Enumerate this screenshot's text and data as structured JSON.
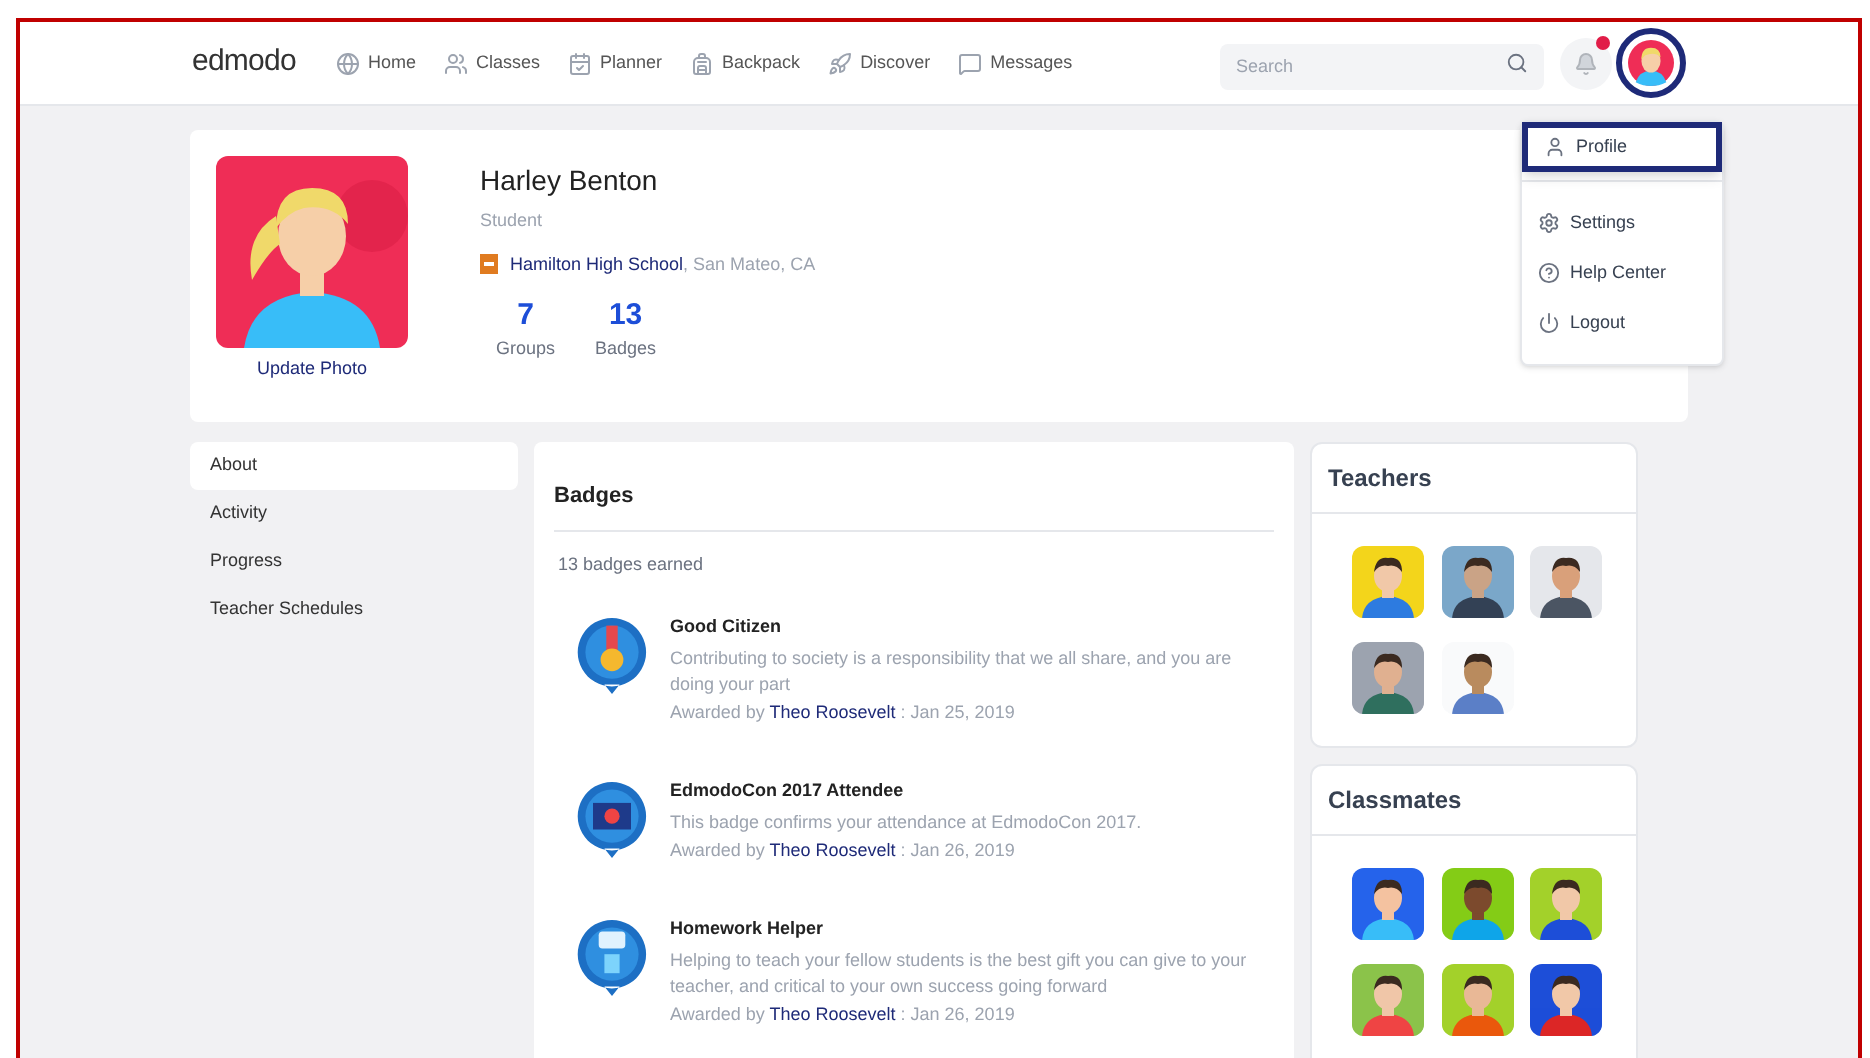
{
  "nav": {
    "logo": "edmodo",
    "items": [
      {
        "label": "Home",
        "kind": "home"
      },
      {
        "label": "Classes",
        "kind": "classes"
      },
      {
        "label": "Planner",
        "kind": "planner"
      },
      {
        "label": "Backpack",
        "kind": "backpack"
      },
      {
        "label": "Discover",
        "kind": "discover"
      },
      {
        "label": "Messages",
        "kind": "messages"
      }
    ],
    "search": {
      "placeholder": "Search"
    },
    "notification_dot": true
  },
  "account_menu": {
    "items": [
      {
        "label": "Profile",
        "kind": "profile",
        "selected": true
      },
      {
        "label": "Settings",
        "kind": "settings",
        "selected": false
      },
      {
        "label": "Help Center",
        "kind": "help",
        "selected": false
      },
      {
        "label": "Logout",
        "kind": "logout",
        "selected": false
      }
    ]
  },
  "profile": {
    "name": "Harley Benton",
    "role": "Student",
    "school": "Hamilton High School",
    "location": ", San Mateo, CA",
    "update_photo": "Update Photo",
    "stats": [
      {
        "value": "7",
        "label": "Groups"
      },
      {
        "value": "13",
        "label": "Badges"
      }
    ]
  },
  "sidebar": {
    "items": [
      {
        "label": "About",
        "selected": true
      },
      {
        "label": "Activity",
        "selected": false
      },
      {
        "label": "Progress",
        "selected": false
      },
      {
        "label": "Teacher Schedules",
        "selected": false
      }
    ]
  },
  "badges": {
    "title": "Badges",
    "count": "13 badges earned",
    "items": [
      {
        "kind": "medal",
        "name": "Good Citizen",
        "description": "Contributing to society is a responsibility that we all share, and you are doing your part",
        "awarded": "Awarded by",
        "teacher": "Theo Roosevelt",
        "date": ": Jan 25, 2019"
      },
      {
        "kind": "screen",
        "name": "EdmodoCon 2017 Attendee",
        "description": "This badge confirms your attendance at EdmodoCon 2017.",
        "awarded": "Awarded by",
        "teacher": "Theo Roosevelt",
        "date": ": Jan 26, 2019"
      },
      {
        "kind": "helper",
        "name": "Homework Helper",
        "description": "Helping to teach your fellow students is the best gift you can give to your teacher, and critical to your own success going forward",
        "awarded": "Awarded by",
        "teacher": "Theo Roosevelt",
        "date": ": Jan 26, 2019"
      }
    ]
  },
  "teachers": {
    "title": "Teachers"
  },
  "classmates": {
    "title": "Classmates"
  }
}
